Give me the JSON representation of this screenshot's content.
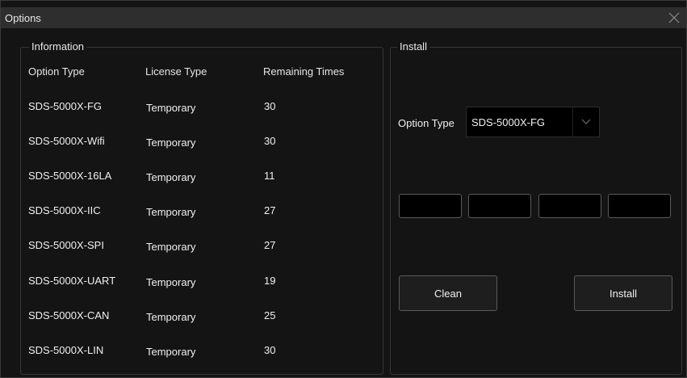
{
  "window": {
    "title": "Options"
  },
  "information": {
    "title": "Information",
    "headers": {
      "option_type": "Option Type",
      "license_type": "License Type",
      "remaining_times": "Remaining Times"
    },
    "rows": [
      {
        "option": "SDS-5000X-FG",
        "license": "Temporary",
        "remaining": "30"
      },
      {
        "option": "SDS-5000X-Wifi",
        "license": "Temporary",
        "remaining": "30"
      },
      {
        "option": "SDS-5000X-16LA",
        "license": "Temporary",
        "remaining": "11"
      },
      {
        "option": "SDS-5000X-IIC",
        "license": "Temporary",
        "remaining": "27"
      },
      {
        "option": "SDS-5000X-SPI",
        "license": "Temporary",
        "remaining": "27"
      },
      {
        "option": "SDS-5000X-UART",
        "license": "Temporary",
        "remaining": "19"
      },
      {
        "option": "SDS-5000X-CAN",
        "license": "Temporary",
        "remaining": "25"
      },
      {
        "option": "SDS-5000X-LIN",
        "license": "Temporary",
        "remaining": "30"
      }
    ]
  },
  "install": {
    "title": "Install",
    "option_type_label": "Option Type",
    "option_type_value": "SDS-5000X-FG",
    "key_fields": [
      "",
      "",
      "",
      ""
    ],
    "clean_label": "Clean",
    "install_label": "Install"
  },
  "icons": {
    "close": "close-icon",
    "dropdown": "chevron-down-icon"
  }
}
